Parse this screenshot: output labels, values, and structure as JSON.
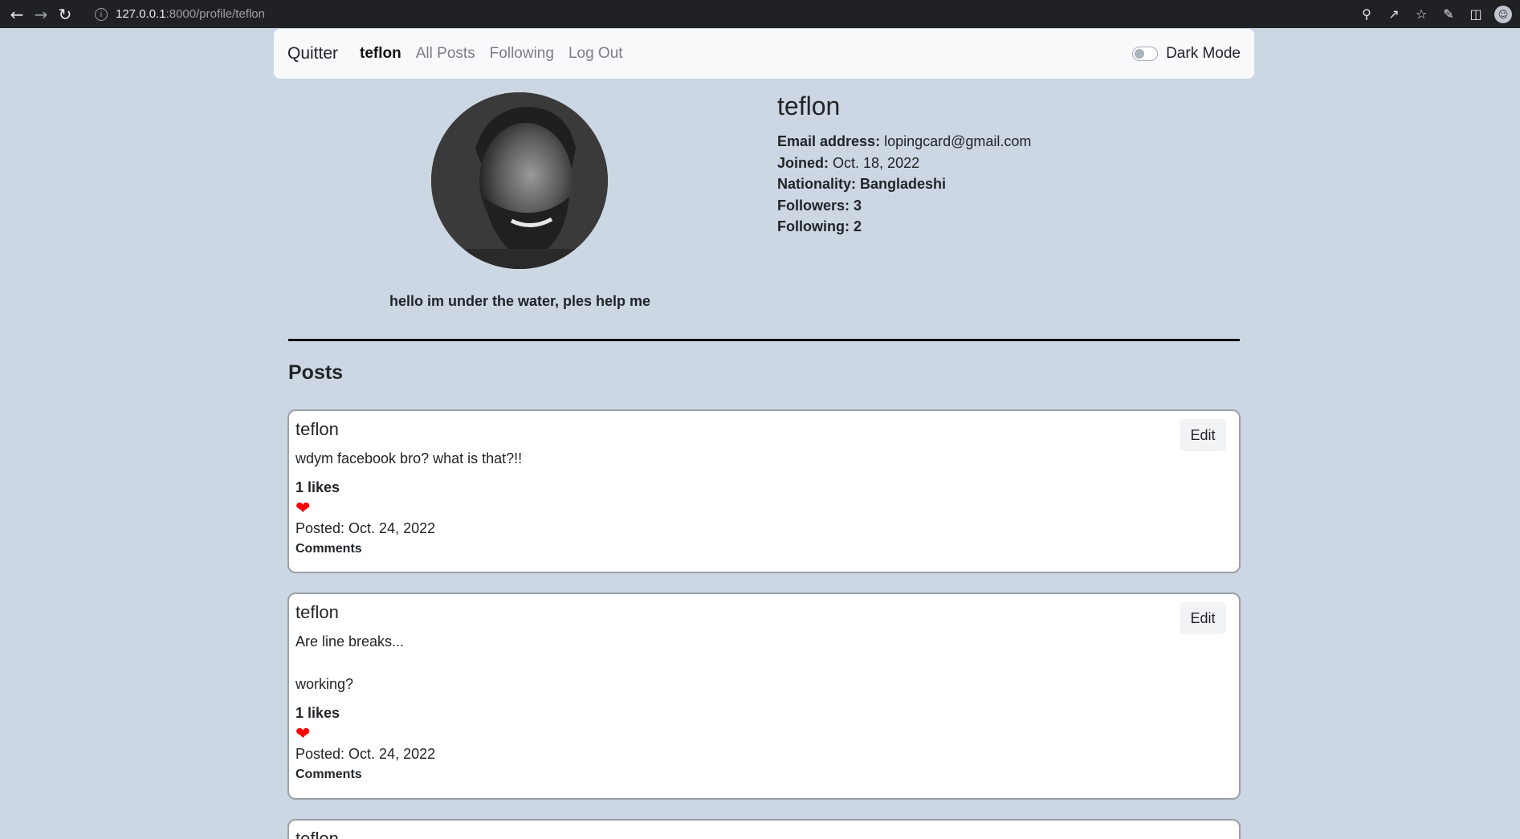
{
  "browser": {
    "url_host": "127.0.0.1",
    "url_path": ":8000/profile/teflon"
  },
  "navbar": {
    "brand": "Quitter",
    "links": [
      "teflon",
      "All Posts",
      "Following",
      "Log Out"
    ],
    "dark_mode_label": "Dark Mode"
  },
  "profile": {
    "username": "teflon",
    "email_label": "Email address:",
    "email": "lopingcard@gmail.com",
    "joined_label": "Joined:",
    "joined": "Oct. 18, 2022",
    "nationality": "Nationality: Bangladeshi",
    "followers": "Followers: 3",
    "following": "Following: 2",
    "bio": "hello im under the water, ples help me"
  },
  "posts_heading": "Posts",
  "posts": [
    {
      "author": "teflon",
      "body": "wdym facebook bro? what is that?!!",
      "likes": "1 likes",
      "posted": "Posted: Oct. 24, 2022",
      "comments": "Comments",
      "edit": "Edit"
    },
    {
      "author": "teflon",
      "body": "Are line breaks...\n\nworking?",
      "likes": "1 likes",
      "posted": "Posted: Oct. 24, 2022",
      "comments": "Comments",
      "edit": "Edit"
    },
    {
      "author": "teflon"
    }
  ],
  "colors": {
    "background": "#cdd7e3",
    "heart": "#ff0000"
  }
}
